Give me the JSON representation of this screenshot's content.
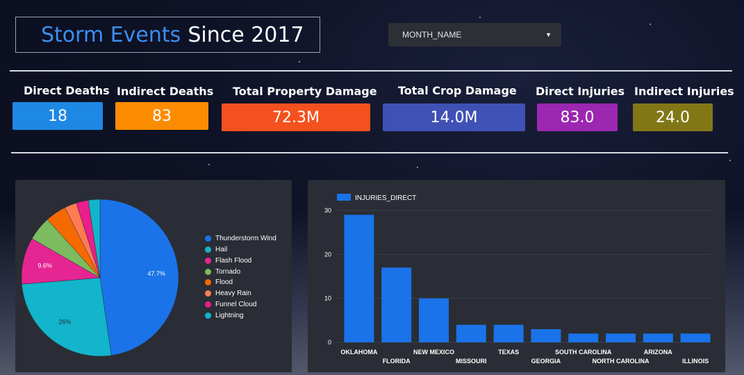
{
  "header": {
    "title_part1": "Storm Events",
    "title_part2": "Since 2017"
  },
  "filter": {
    "label": "MONTH_NAME",
    "caret_icon": "caret-down-icon"
  },
  "kpis": [
    {
      "label": "Direct Deaths",
      "value": "18",
      "color": "#1e88e5"
    },
    {
      "label": "Indirect Deaths",
      "value": "83",
      "color": "#fb8c00"
    },
    {
      "label": "Total Property Damage",
      "value": "72.3M",
      "color": "#f4511e"
    },
    {
      "label": "Total Crop Damage",
      "value": "14.0M",
      "color": "#3f51b5"
    },
    {
      "label": "Direct Injuries",
      "value": "83.0",
      "color": "#9c27b0"
    },
    {
      "label": "Indirect Injuries",
      "value": "24.0",
      "color": "#827717"
    }
  ],
  "chart_data": [
    {
      "type": "pie",
      "categories": [
        "Thunderstorm Wind",
        "Hail",
        "Flash Flood",
        "Tornado",
        "Flood",
        "Heavy Rain",
        "Funnel Cloud",
        "Lightning"
      ],
      "values": [
        47.7,
        26.0,
        9.6,
        5.0,
        4.3,
        2.5,
        2.5,
        2.4
      ],
      "colors": [
        "#1a73e8",
        "#12b5cb",
        "#e52592",
        "#7cbb5f",
        "#f56a00",
        "#ff7b54",
        "#e91e8c",
        "#12b5cb"
      ],
      "slice_labels": [
        "47.7%",
        "26%",
        "9.6%",
        "",
        "",
        "",
        "",
        ""
      ],
      "legend_position": "right"
    },
    {
      "type": "bar",
      "categories": [
        "OKLAHOMA",
        "FLORIDA",
        "NEW MEXICO",
        "MISSOURI",
        "TEXAS",
        "GEORGIA",
        "SOUTH CAROLINA",
        "NORTH CAROLINA",
        "ARIZONA",
        "ILLINOIS"
      ],
      "series": [
        {
          "name": "INJURIES_DIRECT",
          "values": [
            29,
            17,
            10,
            4,
            4,
            3,
            2,
            2,
            2,
            2
          ],
          "color": "#1a73e8"
        }
      ],
      "yticks": [
        "0",
        "10",
        "20",
        "30"
      ],
      "ylim": [
        0,
        30
      ],
      "grid": true,
      "legend_position": "top-left"
    }
  ]
}
